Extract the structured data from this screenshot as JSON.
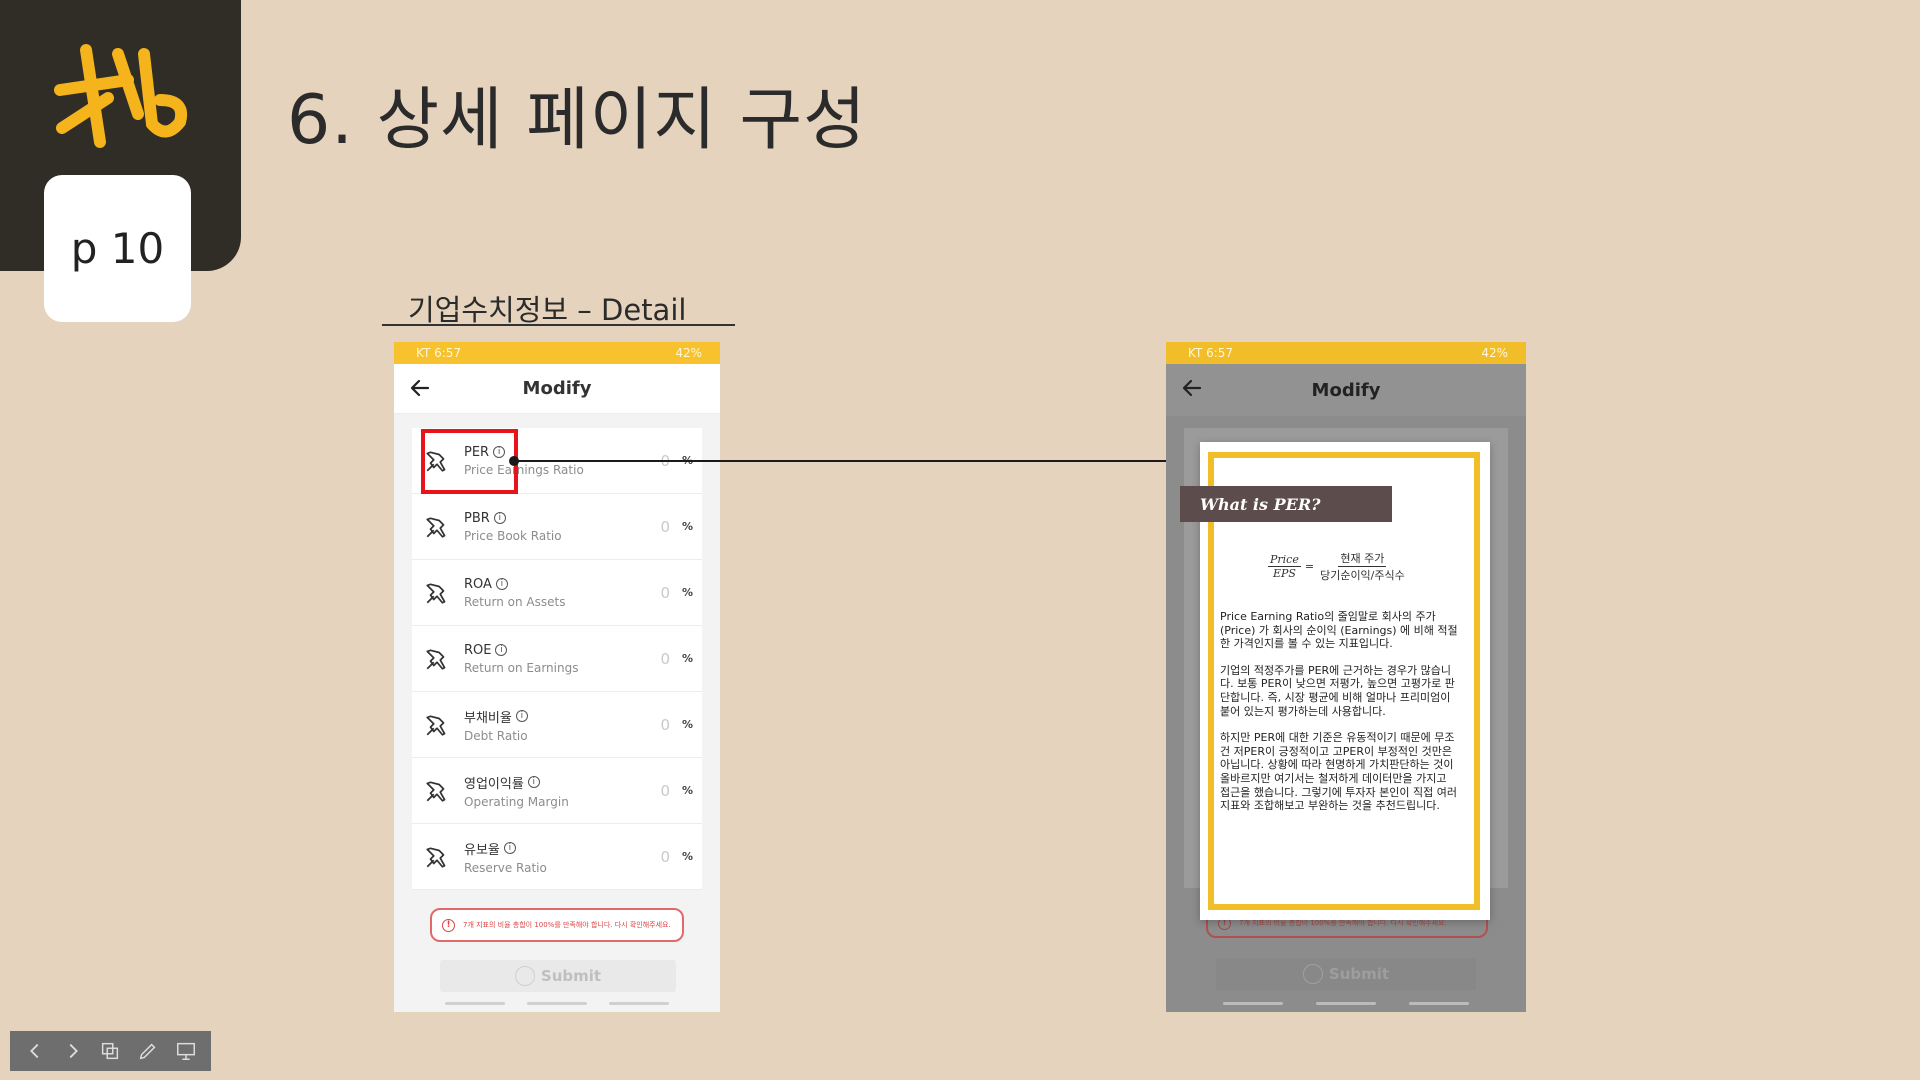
{
  "brand": {
    "logo_text": "Kb",
    "accent": "#f5b41c",
    "dark": "#302c26"
  },
  "page": {
    "number_label": "p 10"
  },
  "title": "6. 상세 페이지 구성",
  "subtitle": "기업수치정보 – Detail",
  "phone": {
    "status_left": "KT 6:57",
    "status_right": "42%",
    "app_title": "Modify",
    "metrics": [
      {
        "name": "PER",
        "desc": "Price Earnings Ratio",
        "value": "0",
        "unit": "%"
      },
      {
        "name": "PBR",
        "desc": "Price Book Ratio",
        "value": "0",
        "unit": "%"
      },
      {
        "name": "ROA",
        "desc": "Return on Assets",
        "value": "0",
        "unit": "%"
      },
      {
        "name": "ROE",
        "desc": "Return on Earnings",
        "value": "0",
        "unit": "%"
      },
      {
        "name": "부채비율",
        "desc": "Debt Ratio",
        "value": "0",
        "unit": "%"
      },
      {
        "name": "영업이익률",
        "desc": "Operating Margin",
        "value": "0",
        "unit": "%"
      },
      {
        "name": "유보율",
        "desc": "Reserve Ratio",
        "value": "0",
        "unit": "%"
      }
    ],
    "warning": "7개 지표의 비율 총합이 100%를 만족해야 합니다. 다시 확인해주세요.",
    "submit_label": "Submit"
  },
  "dialog": {
    "banner": "What is PER?",
    "formula_left_num": "Price",
    "formula_left_den": "EPS",
    "formula_equals": "=",
    "formula_right_num": "현재 주가",
    "formula_right_den": "당기순이익/주식수",
    "para1": "Price Earning Ratio의 줄임말로 회사의 주가 (Price) 가 회사의 순이익 (Earnings) 에 비해 적절한 가격인지를 볼 수 있는 지표입니다.",
    "para2": "기업의 적정주가를 PER에 근거하는 경우가 많습니다. 보통 PER이 낮으면 저평가, 높으면 고평가로 판단합니다. 즉, 시장 평균에 비해 얼마나 프리미엄이 붙어 있는지 평가하는데 사용합니다.",
    "para3": "하지만 PER에 대한 기준은 유동적이기 때문에 무조건 저PER이 긍정적이고 고PER이 부정적인 것만은 아닙니다. 상황에 따라 현명하게 가치판단하는 것이 올바르지만 여기서는 철저하게 데이터만을 가지고 접근을 했습니다. 그렇기에 투자자 본인이 직접 여러 지표와 조합해보고 부완하는 것을 추천드립니다."
  },
  "toolbar": {
    "icons": [
      "chevron-left-icon",
      "chevron-right-icon",
      "copy-icon",
      "pen-icon",
      "presenter-icon"
    ]
  }
}
